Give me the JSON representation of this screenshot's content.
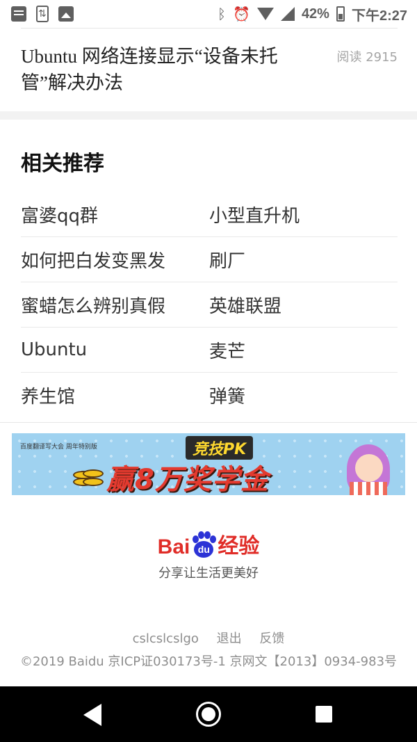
{
  "status_bar": {
    "icons_left": [
      "document-icon",
      "update-icon",
      "image-icon"
    ],
    "icons_right": [
      "bluetooth-icon",
      "alarm-icon",
      "wifi-icon",
      "signal-icon",
      "battery-icon"
    ],
    "battery": "42%",
    "battery_level": 0.42,
    "time": "下午2:27"
  },
  "article": {
    "title": "Ubuntu 网络连接显示“设备未托管”解决办法",
    "read_count": "阅读 2915"
  },
  "related": {
    "title": "相关推荐",
    "rows": [
      [
        "富婆qq群",
        "小型直升机"
      ],
      [
        "如何把白发变黑发",
        "刷厂"
      ],
      [
        "蜜蜡怎么辨别真假",
        "英雄联盟"
      ],
      [
        "Ubuntu",
        "麦芒"
      ],
      [
        "养生馆",
        "弹簧"
      ]
    ]
  },
  "banner": {
    "small_text": "百度翻译写大会 周年特别版",
    "tag": "竞技PK",
    "headline": "赢8万奖学金"
  },
  "brand": {
    "logo_left": "Bai",
    "logo_paw": "du",
    "logo_right": "经验",
    "slogan": "分享让生活更美好"
  },
  "footer": {
    "username": "cslcslcslgo",
    "logout": "退出",
    "feedback": "反馈",
    "copyright": "©2019 Baidu 京ICP证030173号-1 京网文【2013】0934-983号"
  },
  "colors": {
    "brand_red": "#e02d28",
    "brand_blue": "#2c33d6",
    "meta_gray": "#a5a5a5",
    "banner_blue": "#9fd2f0"
  }
}
